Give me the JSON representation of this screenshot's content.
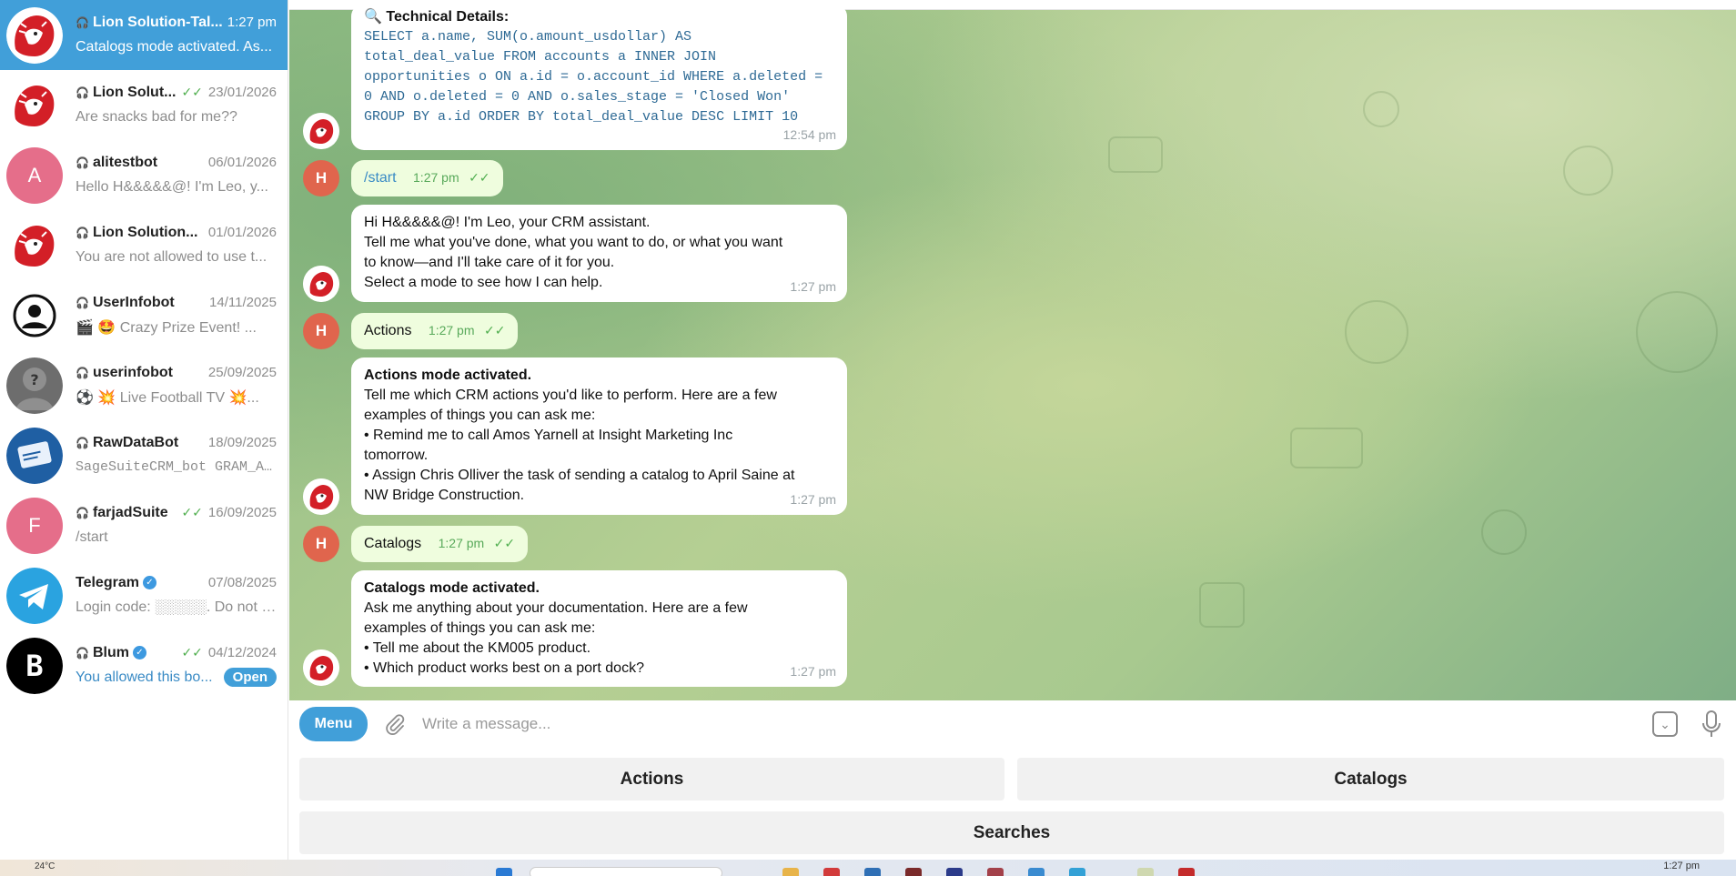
{
  "sidebar": {
    "chats": [
      {
        "name": "Lion Solution-Tal...",
        "date": "1:27 pm",
        "preview": "Catalogs mode activated. As...",
        "avatar": "lion",
        "active": true,
        "ticks": ""
      },
      {
        "name": "Lion Solut...",
        "date": "23/01/2026",
        "preview": "Are snacks bad for me??",
        "avatar": "lion",
        "ticks": "✓✓"
      },
      {
        "name": "alitestbot",
        "date": "06/01/2026",
        "preview": "Hello H&&&&&@! I'm Leo, y...",
        "avatar": "letter",
        "letter": "A",
        "color": "#e56e8a",
        "ticks": ""
      },
      {
        "name": "Lion Solution...",
        "date": "01/01/2026",
        "preview": "You are not allowed to use t...",
        "avatar": "lion",
        "ticks": ""
      },
      {
        "name": "UserInfobot",
        "date": "14/11/2025",
        "preview": "🎬 🤩 Crazy Prize Event! ...",
        "avatar": "person",
        "ticks": ""
      },
      {
        "name": "userinfobot",
        "date": "25/09/2025",
        "preview": "⚽ 💥 Live Football TV 💥...",
        "avatar": "question",
        "ticks": ""
      },
      {
        "name": "RawDataBot",
        "date": "18/09/2025",
        "preview": "SageSuiteCRM_bot  GRAM_A...",
        "avatar": "rawdata",
        "ticks": "",
        "mono": true
      },
      {
        "name": "farjadSuite",
        "date": "16/09/2025",
        "preview": "/start",
        "avatar": "letter",
        "letter": "F",
        "color": "#e56e8a",
        "ticks": "✓✓"
      },
      {
        "name": "Telegram",
        "date": "07/08/2025",
        "preview": "Login code: ░░░░░. Do not gi...",
        "avatar": "telegram",
        "verified": true,
        "ticks": "",
        "nobot": true
      },
      {
        "name": "Blum",
        "date": "04/12/2024",
        "preview": "You allowed this bo...",
        "avatar": "blum",
        "verified": true,
        "ticks": "✓✓",
        "link": true,
        "button": "Open"
      }
    ]
  },
  "messages": {
    "m1": {
      "heading": "🔍 Technical Details:",
      "code": [
        "SELECT a.name, SUM(o.amount_usdollar) AS",
        "total_deal_value FROM accounts a INNER JOIN",
        "opportunities o ON a.id = o.account_id WHERE a.deleted =",
        "0 AND o.deleted = 0 AND o.sales_stage = 'Closed Won'",
        "GROUP BY a.id ORDER BY total_deal_value DESC LIMIT 10"
      ],
      "time": "12:54 pm"
    },
    "m2": {
      "text": "/start",
      "time": "1:27 pm",
      "avatar": "H"
    },
    "m3": {
      "lines": [
        "Hi H&&&&&@! I'm Leo, your CRM assistant.",
        "Tell me what you've done, what you want to do, or what you want",
        "to know—and I'll take care of it for you.",
        "Select a mode to see how I can help."
      ],
      "time": "1:27 pm"
    },
    "m4": {
      "text": "Actions",
      "time": "1:27 pm",
      "avatar": "H"
    },
    "m5": {
      "heading": "Actions mode activated.",
      "lines": [
        "Tell me which CRM actions you'd like to perform. Here are a few",
        "examples of things you can ask me:",
        "• Remind me to call Amos Yarnell at Insight Marketing Inc",
        "tomorrow.",
        "• Assign Chris Olliver the task of sending a catalog to April Saine at",
        "NW Bridge Construction."
      ],
      "time": "1:27 pm"
    },
    "m6": {
      "text": "Catalogs",
      "time": "1:27 pm",
      "avatar": "H"
    },
    "m7": {
      "heading": "Catalogs mode activated.",
      "lines": [
        "Ask me anything about your documentation. Here are a few",
        "examples of things you can ask me:",
        "• Tell me about the KM005 product.",
        "• Which product works best on a port dock?"
      ],
      "time": "1:27 pm"
    }
  },
  "composer": {
    "menu_label": "Menu",
    "placeholder": "Write a message..."
  },
  "keyboard": {
    "actions": "Actions",
    "catalogs": "Catalogs",
    "searches": "Searches"
  },
  "taskbar": {
    "temperature": "24°C",
    "clock": "1:27 pm"
  },
  "colors": {
    "accent": "#419fd9",
    "outgoing_bubble": "#effdde",
    "check_marks": "#4fae4e"
  }
}
